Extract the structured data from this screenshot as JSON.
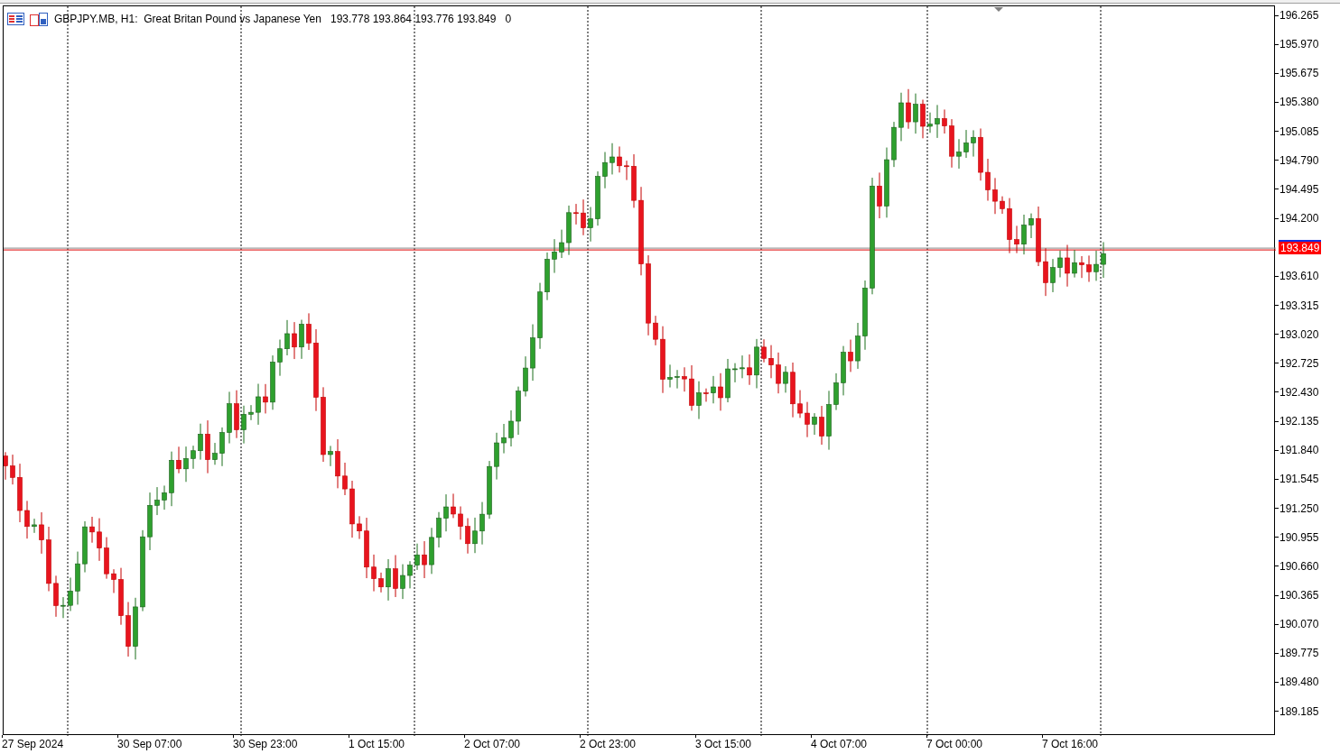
{
  "header": {
    "symbol": "GBPJPY.MB, H1:  Great Britan Pound vs Japanese Yen",
    "ohlc": "193.778 193.864 193.776 193.849",
    "volume": "0"
  },
  "price_scale_upper": [
    "196.265",
    "195.970",
    "195.675",
    "195.380",
    "195.085",
    "194.790",
    "194.495",
    "194.200"
  ],
  "current_price": "193.849",
  "price_scale_lower": [
    "193.610",
    "193.315",
    "193.020",
    "192.725",
    "192.430",
    "192.135",
    "191.840",
    "191.545",
    "191.250",
    "190.955",
    "190.660",
    "190.365",
    "190.070",
    "189.775",
    "189.480",
    "189.185"
  ],
  "time_scale": [
    "27 Sep 2024",
    "30 Sep 07:00",
    "30 Sep 23:00",
    "1 Oct 15:00",
    "2 Oct 07:00",
    "2 Oct 23:00",
    "3 Oct 15:00",
    "4 Oct 07:00",
    "7 Oct 00:00",
    "7 Oct 16:00"
  ]
}
